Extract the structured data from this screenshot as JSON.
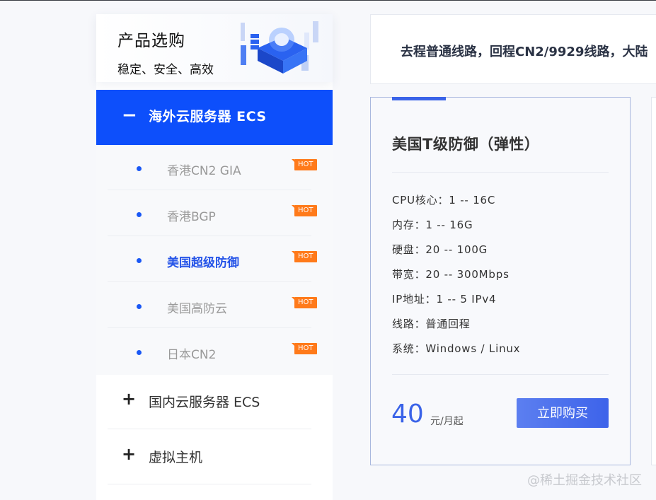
{
  "sidebar": {
    "title": "产品选购",
    "subtitle": "稳定、安全、高效",
    "active_category": {
      "sign": "−",
      "label": "海外云服务器 ECS"
    },
    "sub_items": [
      {
        "label": "香港CN2 GIA",
        "badge": "HOT"
      },
      {
        "label": "香港BGP",
        "badge": "HOT"
      },
      {
        "label": "美国超级防御",
        "badge": "HOT",
        "selected": true
      },
      {
        "label": "美国高防云",
        "badge": "HOT"
      },
      {
        "label": "日本CN2",
        "badge": "HOT"
      }
    ],
    "categories": [
      {
        "sign": "+",
        "label": "国内云服务器 ECS"
      },
      {
        "sign": "+",
        "label": "虚拟主机"
      }
    ]
  },
  "banner": {
    "text": "去程普通线路，回程CN2/9929线路，大陆"
  },
  "card": {
    "title": "美国T级防御（弹性）",
    "specs": [
      "CPU核心：1 -- 16C",
      "内存：1 -- 16G",
      "硬盘：20 -- 100G",
      "带宽：20 -- 300Mbps",
      "IP地址：1 -- 5 IPv4",
      "线路：普通回程",
      "系统：Windows / Linux"
    ],
    "price": "40",
    "price_unit": "元/月起",
    "buy_label": "立即购买"
  },
  "watermark": "@稀土掘金技术社区",
  "colors": {
    "accent": "#0d4ffb",
    "hot_badge": "#ff7a1a",
    "price": "#3a63e8"
  }
}
